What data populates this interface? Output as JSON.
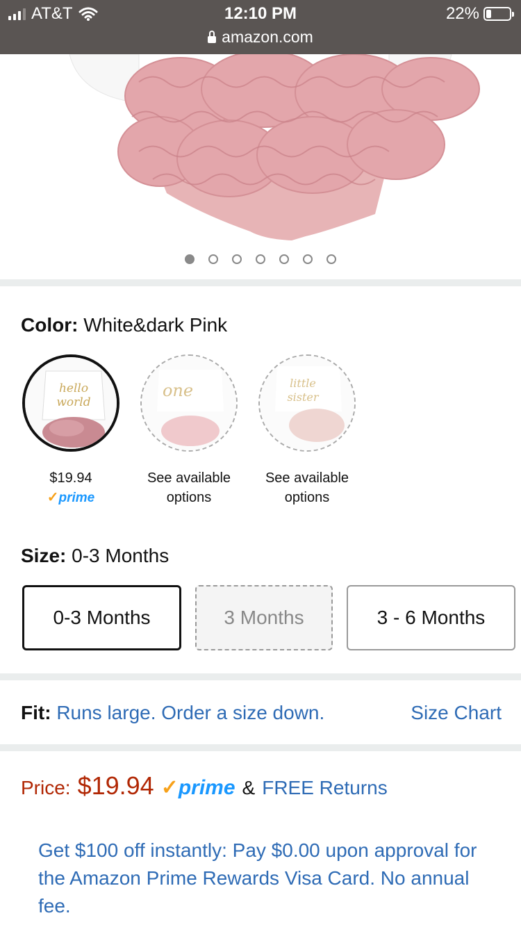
{
  "status_bar": {
    "carrier": "AT&T",
    "time": "12:10 PM",
    "battery": "22%",
    "battery_level": 0.22,
    "url": "amazon.com"
  },
  "gallery": {
    "image_count": 7,
    "active_index": 0
  },
  "color": {
    "label": "Color:",
    "value": "White&dark Pink",
    "options": [
      {
        "name": "hello world",
        "caption_line1": "$19.94",
        "caption_line2": "prime",
        "selected": true
      },
      {
        "name": "one",
        "caption_line1": "See available",
        "caption_line2": "options",
        "selected": false
      },
      {
        "name": "little sister",
        "caption_line1": "See available",
        "caption_line2": "options",
        "selected": false
      }
    ]
  },
  "size": {
    "label": "Size:",
    "value": "0-3 Months",
    "options": [
      "0-3 Months",
      "3 Months",
      "3 - 6 Months"
    ]
  },
  "fit": {
    "label": "Fit:",
    "value": "Runs large. Order a size down.",
    "size_chart": "Size Chart"
  },
  "price": {
    "label": "Price:",
    "value": "$19.94",
    "prime": "prime",
    "returns_prefix": "&",
    "returns": "FREE Returns"
  },
  "promo": {
    "text": "Get $100 off instantly: Pay $0.00 upon approval for the Amazon Prime Rewards Visa Card. No annual fee."
  },
  "colors": {
    "link": "#2e6bb5",
    "price": "#b12704",
    "prime": "#1a98ff",
    "status_bar": "#5a5553",
    "tutu_pink": "#e0a8ad"
  }
}
